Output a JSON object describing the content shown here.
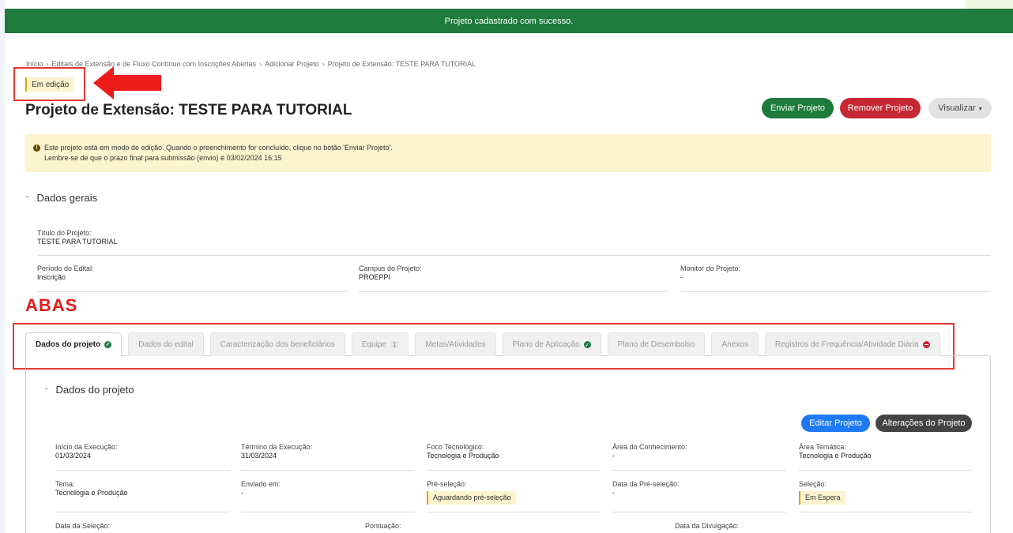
{
  "notification": {
    "message": "Projeto cadastrado com sucesso."
  },
  "breadcrumb": [
    "Início",
    "Editais de Extensão e de Fluxo Contínuo com Inscrições Abertas",
    "Adicionar Projeto",
    "Projeto de Extensão: TESTE PARA TUTORIAL"
  ],
  "status_badge": "Em edição",
  "page_title": "Projeto de Extensão: TESTE PARA TUTORIAL",
  "actions": {
    "send": "Enviar Projeto",
    "remove": "Remover Projeto",
    "view": "Visualizar"
  },
  "alert": {
    "line1": "Este projeto está em modo de edição. Quando o preenchimento for concluído, clique no botão 'Enviar Projeto'.",
    "line2": "Lembre-se de que o prazo final para submissão (envio) é 03/02/2024 16:15"
  },
  "general": {
    "header": "Dados gerais",
    "title_label": "Título do Projeto:",
    "title_value": "TESTE PARA TUTORIAL",
    "period_label": "Período do Edital:",
    "period_value": "Inscrição",
    "campus_label": "Campus do Projeto:",
    "campus_value": "PROEPPI",
    "monitor_label": "Monitor do Projeto:",
    "monitor_value": "-"
  },
  "annotation_label": "ABAS",
  "tabs": [
    {
      "label": "Dados do projeto",
      "active": true,
      "status": "ok"
    },
    {
      "label": "Dados do edital"
    },
    {
      "label": "Caracterização dos beneficiários"
    },
    {
      "label": "Equipe",
      "count": "1"
    },
    {
      "label": "Metas/Atividades"
    },
    {
      "label": "Plano de Aplicação",
      "status": "ok"
    },
    {
      "label": "Plano de Desembolso"
    },
    {
      "label": "Anexos"
    },
    {
      "label": "Registros de Frequência/Atividade Diária",
      "status": "error"
    }
  ],
  "project": {
    "header": "Dados do projeto",
    "edit_button": "Editar Projeto",
    "changes_button": "Alterações do Projeto",
    "row1": [
      {
        "label": "Início da Execução:",
        "value": "01/03/2024"
      },
      {
        "label": "Término da Execução:",
        "value": "31/03/2024"
      },
      {
        "label": "Foco Tecnológico:",
        "value": "Tecnologia e Produção"
      },
      {
        "label": "Área do Conhecimento:",
        "value": "-"
      },
      {
        "label": "Área Temática:",
        "value": "Tecnologia e Produção"
      }
    ],
    "row2": [
      {
        "label": "Tema:",
        "value": "Tecnologia e Produção"
      },
      {
        "label": "Enviado em:",
        "value": "-"
      },
      {
        "label": "Pré-seleção:",
        "value": "Aguardando pré-seleção"
      },
      {
        "label": "Data da Pré-seleção:",
        "value": "-"
      },
      {
        "label": "Seleção:",
        "value": "Em Espera"
      }
    ],
    "row3": [
      {
        "label": "Data da Seleção:"
      },
      {
        "label": "Pontuação:"
      },
      {
        "label": "Data da Divulgação:"
      }
    ]
  }
}
